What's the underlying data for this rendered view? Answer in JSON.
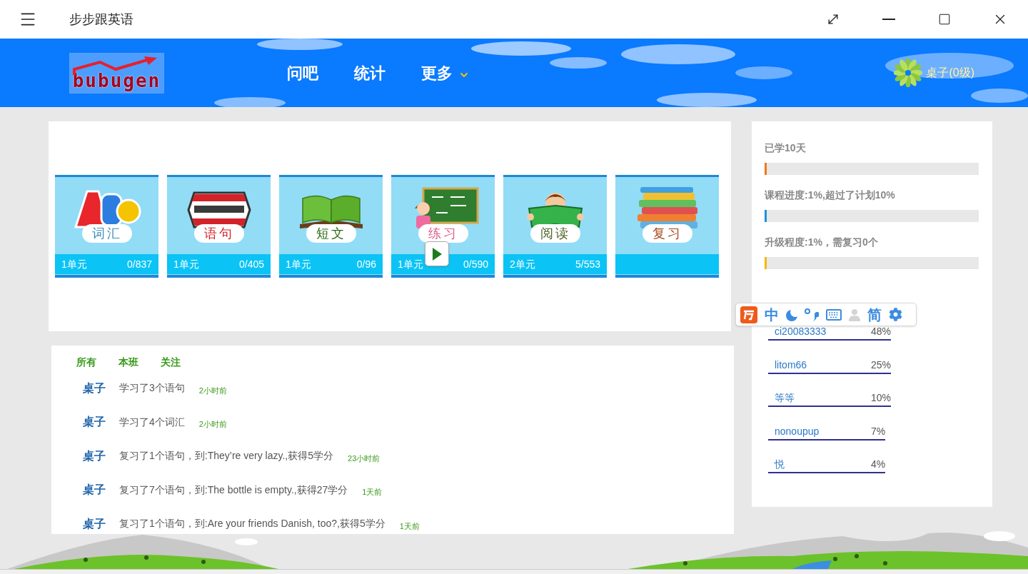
{
  "window": {
    "title": "步步跟英语"
  },
  "header": {
    "logo_text": "bubugen",
    "nav": [
      {
        "label": "问吧",
        "dropdown": false
      },
      {
        "label": "统计",
        "dropdown": false
      },
      {
        "label": "更多",
        "dropdown": true
      }
    ],
    "user": "桌子(0级)"
  },
  "lessons": [
    {
      "kind": "vocabulary",
      "label": "词汇",
      "color": "#3d8fb8",
      "unit": "1单元",
      "progress": "0/837",
      "play": false
    },
    {
      "kind": "sentence",
      "label": "语句",
      "color": "#d3222a",
      "unit": "1单元",
      "progress": "0/405",
      "play": false
    },
    {
      "kind": "passage",
      "label": "短文",
      "color": "#2e6b12",
      "unit": "1单元",
      "progress": "0/96",
      "play": false
    },
    {
      "kind": "practice",
      "label": "练习",
      "color": "#e0608c",
      "unit": "1单元",
      "progress": "0/590",
      "play": true
    },
    {
      "kind": "reading",
      "label": "阅读",
      "color": "#4f6328",
      "unit": "2单元",
      "progress": "5/553",
      "play": false
    },
    {
      "kind": "review",
      "label": "复习",
      "color": "#a3481c",
      "play": false
    }
  ],
  "feed": {
    "tabs": [
      "所有",
      "本班",
      "关注"
    ],
    "items": [
      {
        "user": "桌子",
        "text": "学习了3个语句",
        "time": "2小时前"
      },
      {
        "user": "桌子",
        "text": "学习了4个词汇",
        "time": "2小时前"
      },
      {
        "user": "桌子",
        "text": "复习了1个语句，到:They’re very lazy.,获得5学分",
        "time": "23小时前"
      },
      {
        "user": "桌子",
        "text": "复习了7个语句，到:The bottle is empty.,获得27学分",
        "time": "1天前"
      },
      {
        "user": "桌子",
        "text": "复习了1个语句，到:Are your friends Danish, too?,获得5学分",
        "time": "1天前"
      }
    ]
  },
  "stats": [
    {
      "label": "已学10天",
      "level": 0.01,
      "color": "#f07818"
    },
    {
      "label": "课程进度:1%,超过了计划10%",
      "level": 0.01,
      "color": "#1e8fe0"
    },
    {
      "label": "升级程度:1%，需复习0个",
      "level": 0.01,
      "color": "#f5b800"
    }
  ],
  "ranking": [
    {
      "name": "ci20083333",
      "percent": "48%"
    },
    {
      "name": "litom66",
      "percent": "25%"
    },
    {
      "name": "等等",
      "percent": "10%"
    },
    {
      "name": "nonoupup",
      "percent": "7%"
    },
    {
      "name": "悦",
      "percent": "4%"
    }
  ],
  "ime_toolbar": {
    "mode": "中",
    "charset": "简"
  }
}
